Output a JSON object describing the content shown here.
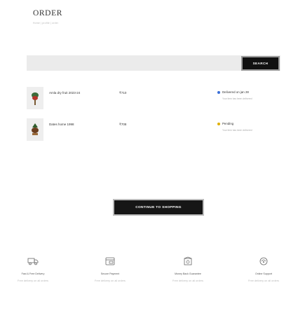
{
  "page": {
    "title": "ORDER",
    "breadcrumb": "Home  |  profile  |  order"
  },
  "search": {
    "button_label": "SEARCH",
    "placeholder": ""
  },
  "orders": [
    {
      "name": "Amla dry fruit 2023-24",
      "price": "₹710",
      "status": "Delivered on jan 28",
      "status_color": "#3a6fd8",
      "note": "Your item has been delivered"
    },
    {
      "name": "Dates home 1998",
      "price": "₹708",
      "status": "Pending",
      "status_color": "#e0b000",
      "note": "Your item has been delivered"
    }
  ],
  "continue": {
    "label": "CONTINUE TO SHOPPING"
  },
  "features": [
    {
      "icon": "truck-icon",
      "title": "Fast & Free Delivery",
      "desc": "Free delivery on all orders"
    },
    {
      "icon": "card-payment-icon",
      "title": "Secure Payment",
      "desc": "Free delivery on all orders"
    },
    {
      "icon": "money-back-icon",
      "title": "Money Back Guarantee",
      "desc": "Free delivery on all orders"
    },
    {
      "icon": "support-icon",
      "title": "Online Support",
      "desc": "Free delivery on all orders"
    }
  ],
  "colors": {
    "button": "#111111",
    "status_delivered": "#3a6fd8",
    "status_pending": "#e0b000"
  }
}
